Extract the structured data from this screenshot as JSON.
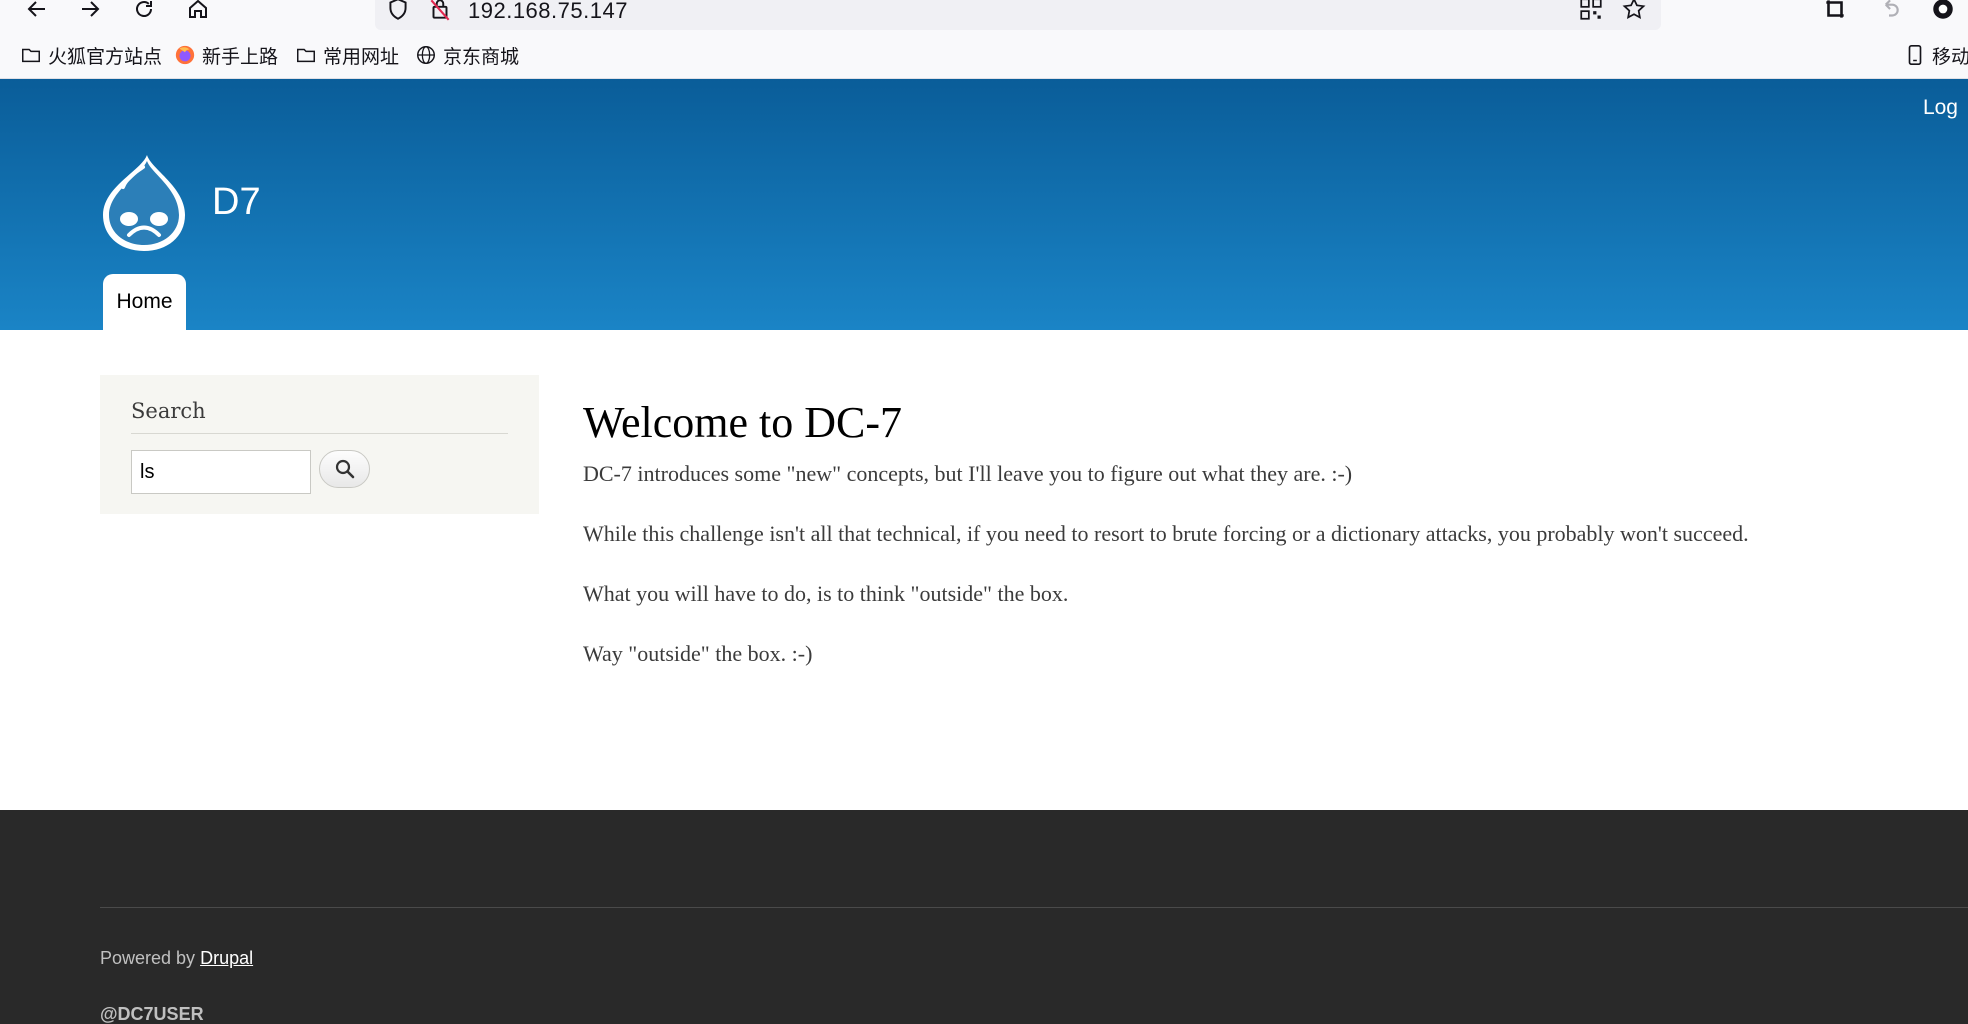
{
  "browser": {
    "url": "192.168.75.147",
    "bookmarks": [
      {
        "label": "火狐官方站点",
        "icon": "folder-icon"
      },
      {
        "label": "新手上路",
        "icon": "firefox-icon"
      },
      {
        "label": "常用网址",
        "icon": "folder-icon"
      },
      {
        "label": "京东商城",
        "icon": "globe-icon"
      }
    ],
    "mobile_bookmarks_label": "移动设"
  },
  "header": {
    "login_label": "Log",
    "site_name": "D7",
    "tabs": [
      {
        "label": "Home"
      }
    ]
  },
  "sidebar": {
    "search_title": "Search",
    "search_value": "ls"
  },
  "main": {
    "title": "Welcome to DC-7",
    "paragraphs": [
      "DC-7 introduces some \"new\" concepts, but I'll leave you to figure out what they are.  :-)",
      "While this challenge isn't all that technical, if you need to resort to brute forcing or a dictionary attacks, you probably won't succeed.",
      "What you will have to do, is to think \"outside\" the box.",
      "Way \"outside\" the box.  :-)"
    ]
  },
  "footer": {
    "powered_prefix": "Powered by",
    "powered_link": "Drupal",
    "user_text": "@DC7USER"
  },
  "colors": {
    "header_top": "#0a5d99",
    "header_bottom": "#1a84c6",
    "footer_bg": "#292929",
    "sidebar_bg": "#f6f6f2"
  }
}
